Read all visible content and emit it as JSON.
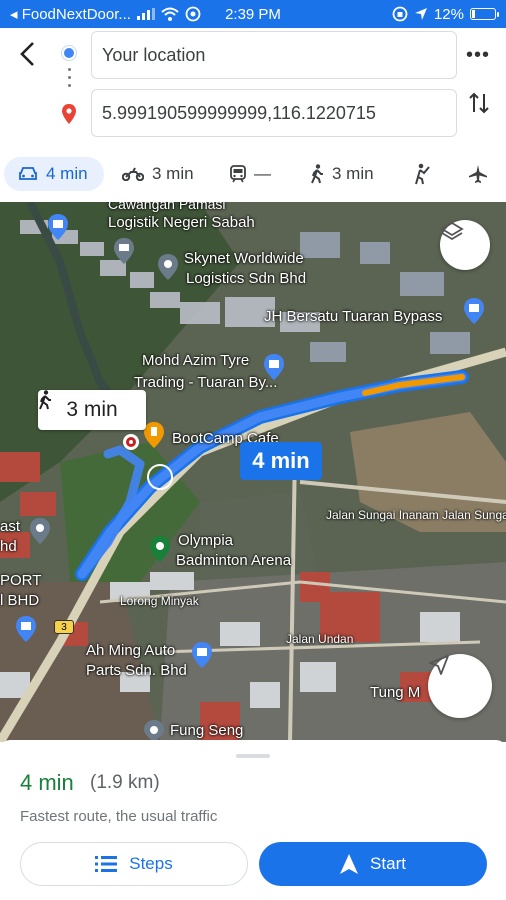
{
  "status_bar": {
    "carrier": "◂ FoodNextDoor...",
    "time": "2:39 PM",
    "battery": "12%",
    "battery_level": 0.12
  },
  "directions": {
    "origin": "Your location",
    "destination": "5.999190599999999,116.1220715"
  },
  "modes": [
    {
      "name": "drive",
      "label": "4 min",
      "active": true
    },
    {
      "name": "motorcycle",
      "label": "3 min"
    },
    {
      "name": "transit",
      "label": "—"
    },
    {
      "name": "walk",
      "label": "3 min"
    },
    {
      "name": "ride"
    },
    {
      "name": "flight"
    }
  ],
  "map": {
    "labels": {
      "logistik_top": "Cawangan Pamasi",
      "logistik": "Logistik Negeri Sabah",
      "skynet1": "Skynet Worldwide",
      "skynet2": "Logistics Sdn Bhd",
      "jh": "JH Bersatu Tuaran Bypass",
      "mohd1": "Mohd Azim Tyre",
      "mohd2": "Trading - Tuaran By...",
      "bootcamp": "BootCamp Cafe",
      "sungai": "Jalan Sungai Inanam Jalan Sunga",
      "olympia1": "Olympia",
      "olympia2": "Badminton Arena",
      "east1": "ast",
      "east2": "hd",
      "port1": "PORT",
      "port2": "l BHD",
      "lorong": "Lorong Minyak",
      "ahming1": "Ah Ming Auto",
      "ahming2": "Parts Sdn. Bhd",
      "undan": "Jalan Undan",
      "tung": "Tung M",
      "fung": "Fung Seng",
      "road3": "3"
    },
    "walk_time": "3 min",
    "drive_time": "4 min"
  },
  "summary": {
    "time": "4 min",
    "distance": "(1.9 km)",
    "description": "Fastest route, the usual traffic"
  },
  "buttons": {
    "steps": "Steps",
    "start": "Start"
  },
  "colors": {
    "accent": "#1a73e8",
    "route": "#4285f4",
    "traffic": "#f29900",
    "green_time": "#188038"
  }
}
